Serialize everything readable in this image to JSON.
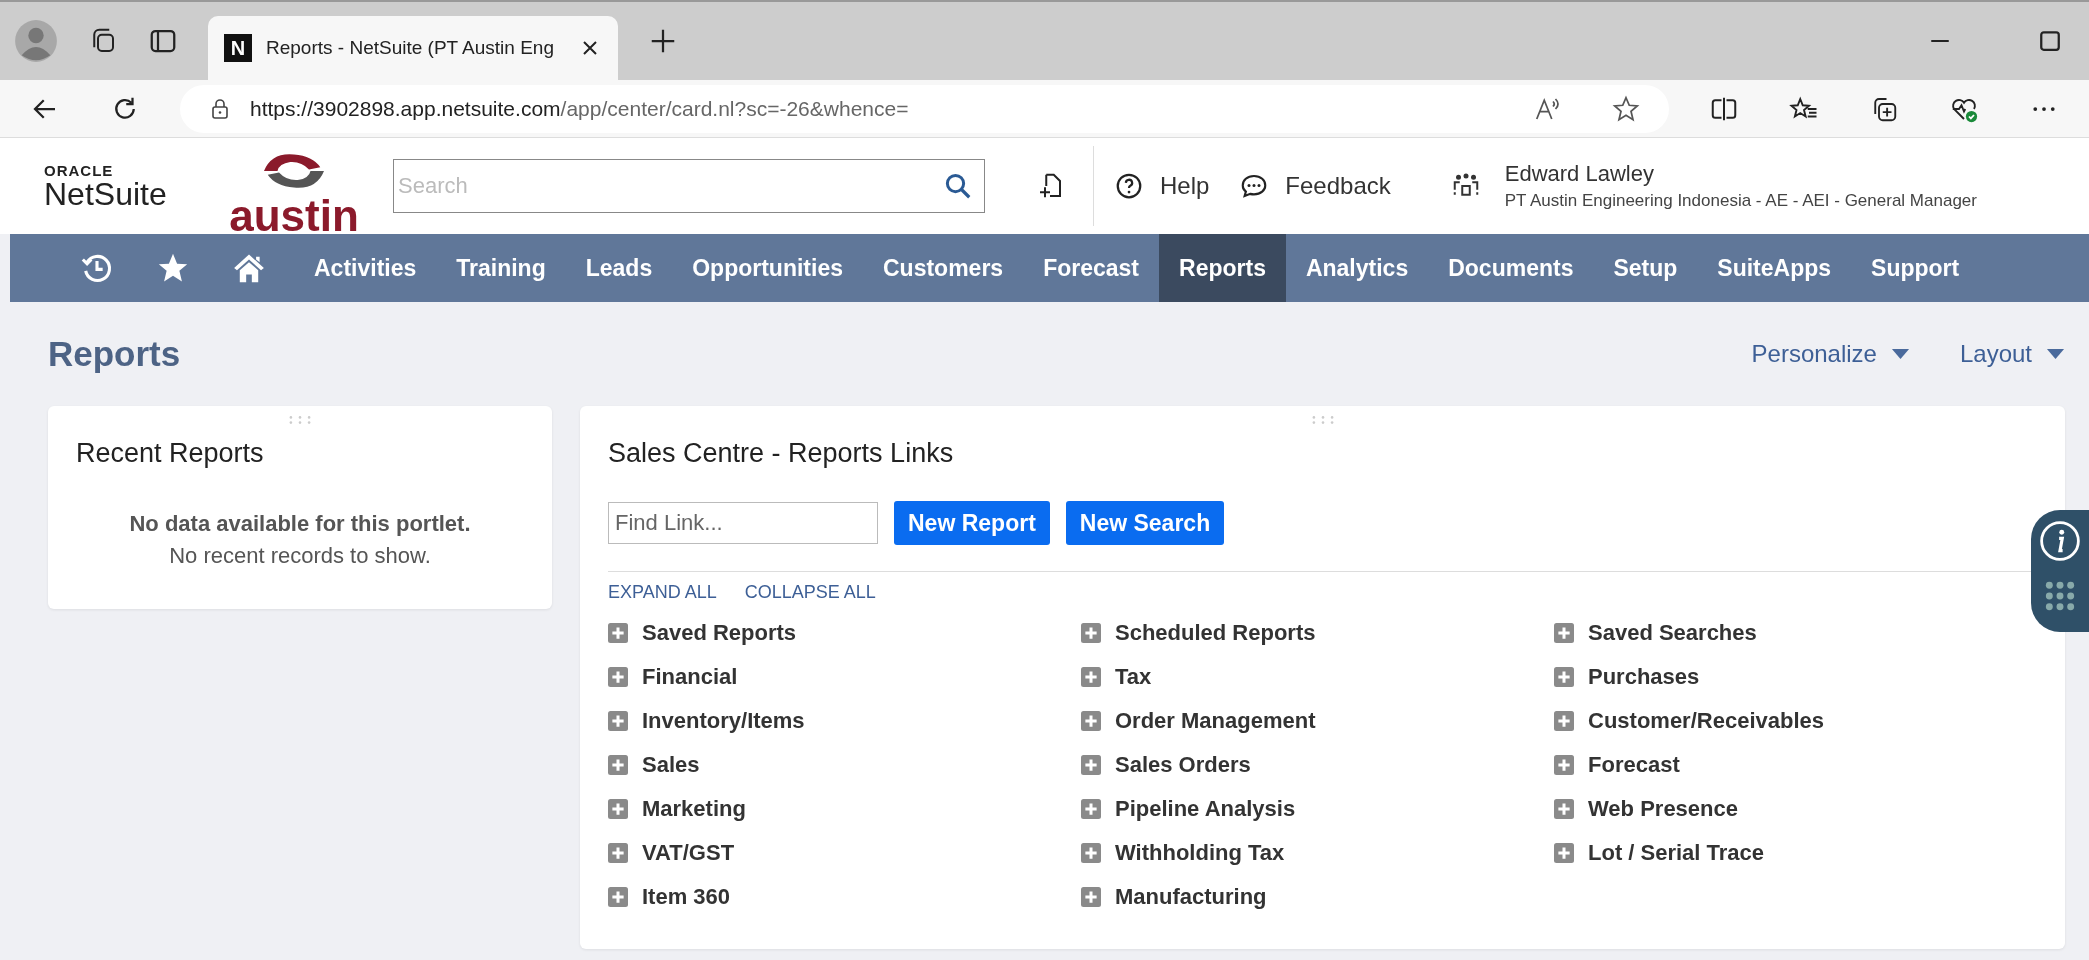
{
  "browser": {
    "tab": {
      "title": "Reports - NetSuite (PT Austin Eng",
      "favicon": "N"
    },
    "url": {
      "host": "https://3902898.app.netsuite.com",
      "path": "/app/center/card.nl?sc=-26&whence="
    }
  },
  "header": {
    "logo": {
      "top": "ORACLE",
      "bottom": "NetSuite"
    },
    "company_logo": "austin",
    "search": {
      "placeholder": "Search"
    },
    "help": "Help",
    "feedback": "Feedback",
    "user": {
      "name": "Edward Lawley",
      "role": "PT Austin Engineering Indonesia - AE - AEI - General Manager"
    }
  },
  "nav": [
    {
      "label": "Activities",
      "selected": false
    },
    {
      "label": "Training",
      "selected": false
    },
    {
      "label": "Leads",
      "selected": false
    },
    {
      "label": "Opportunities",
      "selected": false
    },
    {
      "label": "Customers",
      "selected": false
    },
    {
      "label": "Forecast",
      "selected": false
    },
    {
      "label": "Reports",
      "selected": true
    },
    {
      "label": "Analytics",
      "selected": false
    },
    {
      "label": "Documents",
      "selected": false
    },
    {
      "label": "Setup",
      "selected": false
    },
    {
      "label": "SuiteApps",
      "selected": false
    },
    {
      "label": "Support",
      "selected": false
    }
  ],
  "page": {
    "title": "Reports",
    "menus": [
      "Personalize",
      "Layout"
    ]
  },
  "recent_reports": {
    "title": "Recent Reports",
    "empty_title": "No data available for this portlet.",
    "empty_text": "No recent records to show."
  },
  "report_links": {
    "title": "Sales Centre - Reports Links",
    "find": {
      "placeholder": "Find Link..."
    },
    "buttons": [
      "New Report",
      "New Search"
    ],
    "expand_all": "EXPAND ALL",
    "collapse_all": "COLLAPSE ALL",
    "columns": [
      [
        "Saved Reports",
        "Financial",
        "Inventory/Items",
        "Sales",
        "Marketing",
        "VAT/GST",
        "Item 360"
      ],
      [
        "Scheduled Reports",
        "Tax",
        "Order Management",
        "Sales Orders",
        "Pipeline Analysis",
        "Withholding Tax",
        "Manufacturing"
      ],
      [
        "Saved Searches",
        "Purchases",
        "Customer/Receivables",
        "Forecast",
        "Web Presence",
        "Lot / Serial Trace"
      ]
    ]
  }
}
